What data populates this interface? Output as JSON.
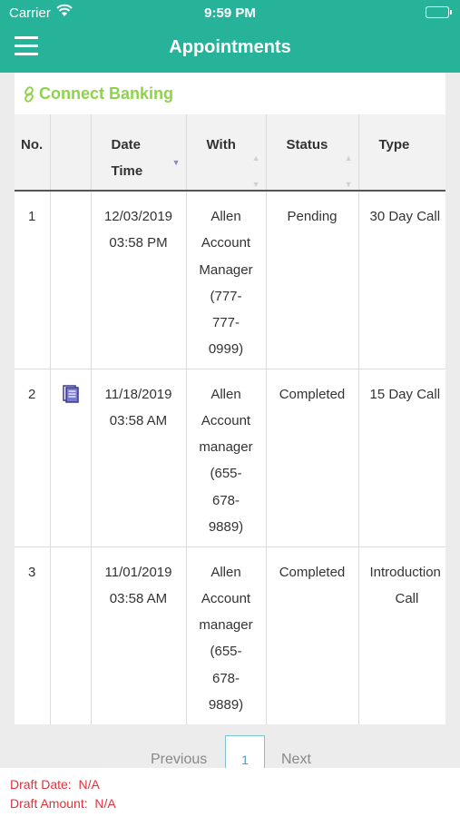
{
  "status_bar": {
    "carrier": "Carrier",
    "time": "9:59 PM"
  },
  "nav": {
    "title": "Appointments"
  },
  "connect_banking": {
    "label": "Connect Banking"
  },
  "table": {
    "headers": {
      "no": "No.",
      "date": "Date",
      "time": "Time",
      "with": "With",
      "status": "Status",
      "type": "Type"
    },
    "rows": [
      {
        "no": "1",
        "has_doc": false,
        "date": "12/03/2019",
        "time": "03:58 PM",
        "with": [
          "Allen",
          "Account",
          "Manager",
          "(777-",
          "777-",
          "0999)"
        ],
        "status": "Pending",
        "type": [
          "30 Day Call"
        ]
      },
      {
        "no": "2",
        "has_doc": true,
        "date": "11/18/2019",
        "time": "03:58 AM",
        "with": [
          "Allen",
          "Account",
          "manager",
          "(655-",
          "678-",
          "9889)"
        ],
        "status": "Completed",
        "type": [
          "15 Day Call"
        ]
      },
      {
        "no": "3",
        "has_doc": false,
        "date": "11/01/2019",
        "time": "03:58 AM",
        "with": [
          "Allen",
          "Account",
          "manager",
          "(655-",
          "678-",
          "9889)"
        ],
        "status": "Completed",
        "type": [
          "Introduction",
          "Call"
        ]
      }
    ]
  },
  "pager": {
    "previous": "Previous",
    "current": "1",
    "next": "Next"
  },
  "footer": {
    "draft_date_label": "Draft Date:",
    "draft_date_value": "N/A",
    "draft_amount_label": "Draft Amount:",
    "draft_amount_value": "N/A"
  },
  "colors": {
    "brand": "#26b39a",
    "connect": "#8fd34a",
    "alert": "#e5303a"
  }
}
